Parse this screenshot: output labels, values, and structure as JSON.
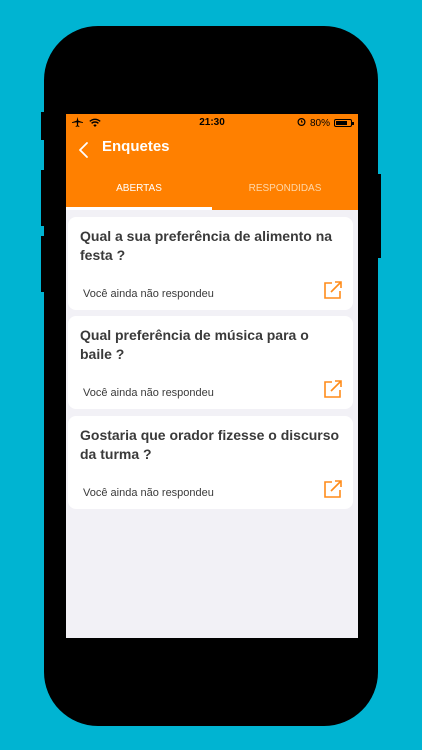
{
  "device": {
    "background_color": "#00b4d2",
    "frame_color": "#000000"
  },
  "status_bar": {
    "time": "21:30",
    "battery_percent": "80%",
    "battery_level": 0.8,
    "icons": [
      "airplane-icon",
      "wifi-icon",
      "alarm-icon",
      "battery-icon"
    ]
  },
  "header": {
    "title": "Enquetes",
    "back_icon": "chevron-left-icon",
    "accent_color": "#ff8000"
  },
  "tabs": [
    {
      "label": "ABERTAS",
      "active": true
    },
    {
      "label": "RESPONDIDAS",
      "active": false
    }
  ],
  "polls": [
    {
      "question": "Qual a sua preferência de alimento na festa ?",
      "status": "Você ainda não respondeu",
      "icon": "open-external-icon"
    },
    {
      "question": "Qual preferência de música para o baile ?",
      "status": "Você ainda não respondeu",
      "icon": "open-external-icon"
    },
    {
      "question": "Gostaria que orador fizesse o discurso da turma ?",
      "status": "Você ainda não respondeu",
      "icon": "open-external-icon"
    }
  ]
}
